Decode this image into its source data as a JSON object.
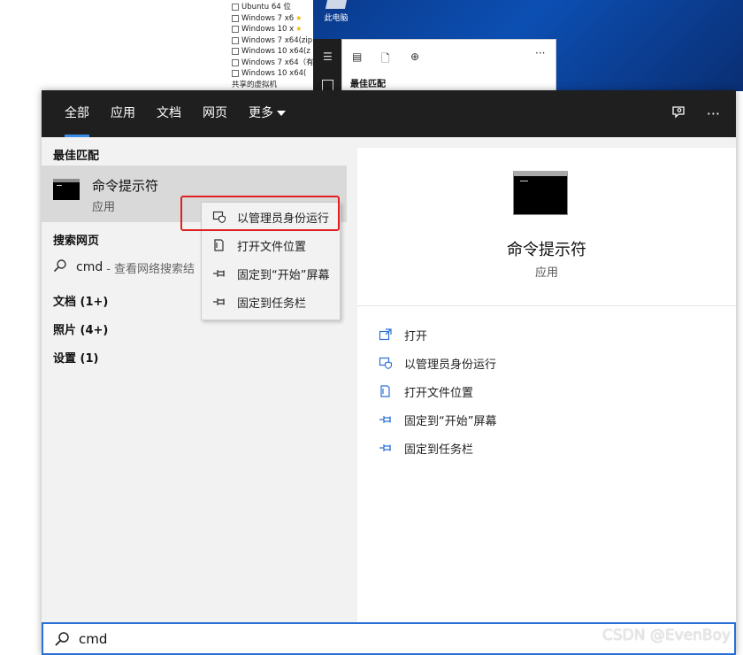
{
  "background": {
    "vm_list": [
      {
        "label": "Ubuntu 64 位",
        "star": false
      },
      {
        "label": "Windows 7 x6",
        "star": true
      },
      {
        "label": "Windows 10 x",
        "star": true
      },
      {
        "label": "Windows 7 x64(zip",
        "star": false
      },
      {
        "label": "Windows 10 x64(z",
        "star": false
      },
      {
        "label": "Windows 7 x64（有",
        "star": false
      },
      {
        "label": "Windows 10 x64(",
        "star": false
      }
    ],
    "vm_footer": "共享的虚拟机",
    "desktop_icon_label": "此电脑",
    "explorer_best_match": "最佳匹配"
  },
  "tabs": [
    {
      "label": "全部",
      "active": true
    },
    {
      "label": "应用",
      "active": false
    },
    {
      "label": "文档",
      "active": false
    },
    {
      "label": "网页",
      "active": false
    },
    {
      "label": "更多",
      "active": false,
      "dropdown": true
    }
  ],
  "left": {
    "best_match_header": "最佳匹配",
    "best_match": {
      "title": "命令提示符",
      "subtitle": "应用"
    },
    "search_web_header": "搜索网页",
    "web_query": "cmd",
    "web_hint": "- 查看网络搜索结",
    "categories": [
      "文档 (1+)",
      "照片 (4+)",
      "设置 (1)"
    ]
  },
  "right": {
    "title": "命令提示符",
    "subtitle": "应用",
    "actions": [
      {
        "label": "打开",
        "icon": "open-icon"
      },
      {
        "label": "以管理员身份运行",
        "icon": "shield-icon"
      },
      {
        "label": "打开文件位置",
        "icon": "file-location-icon"
      },
      {
        "label": "固定到“开始”屏幕",
        "icon": "pin-icon"
      },
      {
        "label": "固定到任务栏",
        "icon": "pin-icon"
      }
    ]
  },
  "context_menu": [
    {
      "label": "以管理员身份运行",
      "icon": "shield-icon"
    },
    {
      "label": "打开文件位置",
      "icon": "file-location-icon"
    },
    {
      "label": "固定到“开始”屏幕",
      "icon": "pin-icon"
    },
    {
      "label": "固定到任务栏",
      "icon": "pin-icon"
    }
  ],
  "search": {
    "value": "cmd"
  },
  "watermark": "CSDN @EvenBoy",
  "colors": {
    "accent": "#2a6fd6",
    "tab_underline": "#3b8ee8",
    "highlight_box": "#e02020",
    "topbar": "#1f1f1f"
  }
}
